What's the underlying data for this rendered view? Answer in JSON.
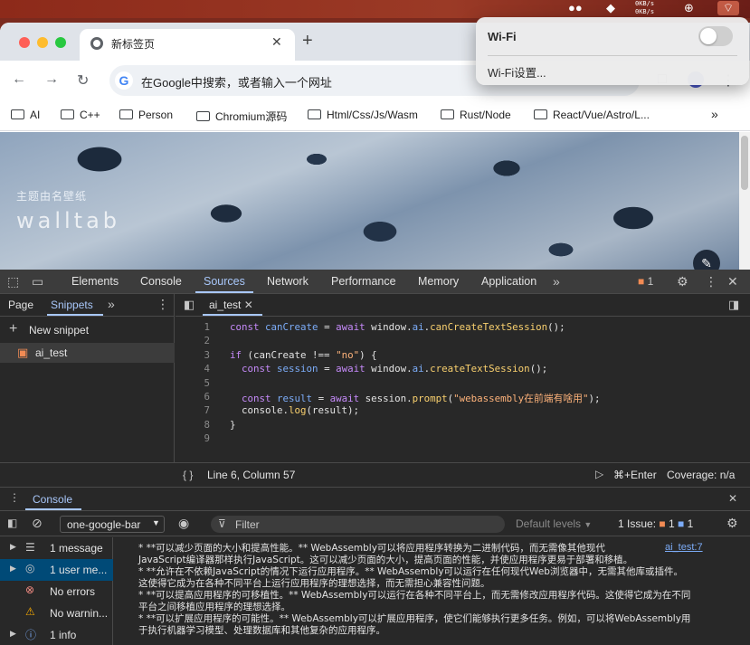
{
  "menubar": {
    "speed_up": "0KB/s",
    "speed_down": "0KB/s"
  },
  "browser": {
    "tab_title": "新标签页",
    "omnibox_placeholder": "在Google中搜索，或者输入一个网址",
    "bookmarks": [
      "AI",
      "C++",
      "Person",
      "Chromium源码",
      "Html/Css/Js/Wasm",
      "Rust/Node",
      "React/Vue/Astro/L..."
    ],
    "bookmarks_overflow": "»"
  },
  "page": {
    "wall_title": "主题由名壁纸",
    "wall_brand": "walltab"
  },
  "wifi_menu": {
    "title": "Wi-Fi",
    "settings": "Wi-Fi设置..."
  },
  "devtools": {
    "tabs": [
      "Elements",
      "Console",
      "Sources",
      "Network",
      "Performance",
      "Memory",
      "Application"
    ],
    "active_tab": "Sources",
    "issue_count": "1",
    "nav_tabs": [
      "Page",
      "Snippets"
    ],
    "new_snippet": "New snippet",
    "snippet_name": "ai_test",
    "editor_tab": "ai_test",
    "code": [
      {
        "n": "1",
        "html": "<span class='kw'>const</span> <span class='prop'>canCreate</span> <span class='op'>=</span> <span class='kw'>await</span> window.<span class='prop'>ai</span>.<span class='fn'>canCreateTextSession</span>();"
      },
      {
        "n": "2",
        "html": ""
      },
      {
        "n": "3",
        "html": "<span class='kw'>if</span> (canCreate <span class='op'>!==</span> <span class='str'>\"no\"</span>) {"
      },
      {
        "n": "4",
        "html": "  <span class='kw'>const</span> <span class='prop'>session</span> <span class='op'>=</span> <span class='kw'>await</span> window.<span class='prop'>ai</span>.<span class='fn'>createTextSession</span>();"
      },
      {
        "n": "5",
        "html": ""
      },
      {
        "n": "6",
        "html": "  <span class='kw'>const</span> <span class='prop'>result</span> <span class='op'>=</span> <span class='kw'>await</span> session.<span class='fn'>prompt</span>(<span class='str'>\"webassembly在前端有啥用\"</span>);"
      },
      {
        "n": "7",
        "html": "  console.<span class='fn'>log</span>(result);"
      },
      {
        "n": "8",
        "html": "}"
      },
      {
        "n": "9",
        "html": ""
      }
    ],
    "status_position": "Line 6, Column 57",
    "run_shortcut": "⌘+Enter",
    "coverage": "Coverage: n/a",
    "drawer_tab": "Console",
    "context": "one-google-bar",
    "filter_placeholder": "Filter",
    "levels": "Default levels",
    "issues_label": "1 Issue:",
    "issues_warn": "1",
    "issues_info": "1",
    "sidebar": [
      {
        "label": "1 message",
        "icon": "list-icon"
      },
      {
        "label": "1 user me...",
        "icon": "user-icon"
      },
      {
        "label": "No errors",
        "icon": "error-icon"
      },
      {
        "label": "No warnin...",
        "icon": "warning-icon"
      },
      {
        "label": "1 info",
        "icon": "info-icon"
      }
    ],
    "log_source": "ai_test:7",
    "log_lines": [
      " * **可以减少页面的大小和提高性能。** WebAssembly可以将应用程序转换为二进制代码，而无需像其他现代",
      "JavaScript编译器那样执行JavaScript。这可以减少页面的大小，提高页面的性能，并使应用程序更易于部署和移植。",
      "* **允许在不依赖JavaScript的情况下运行应用程序。** WebAssembly可以运行在任何现代Web浏览器中，无需其他库或插件。",
      "这使得它成为在各种不同平台上运行应用程序的理想选择，而无需担心兼容性问题。",
      "* **可以提高应用程序的可移植性。** WebAssembly可以运行在各种不同平台上，而无需修改应用程序代码。这使得它成为在不同",
      "平台之间移植应用程序的理想选择。",
      "* **可以扩展应用程序的可能性。** WebAssembly可以扩展应用程序，使它们能够执行更多任务。例如，可以将WebAssembly用",
      "于执行机器学习模型、处理数据库和其他复杂的应用程序。"
    ]
  }
}
